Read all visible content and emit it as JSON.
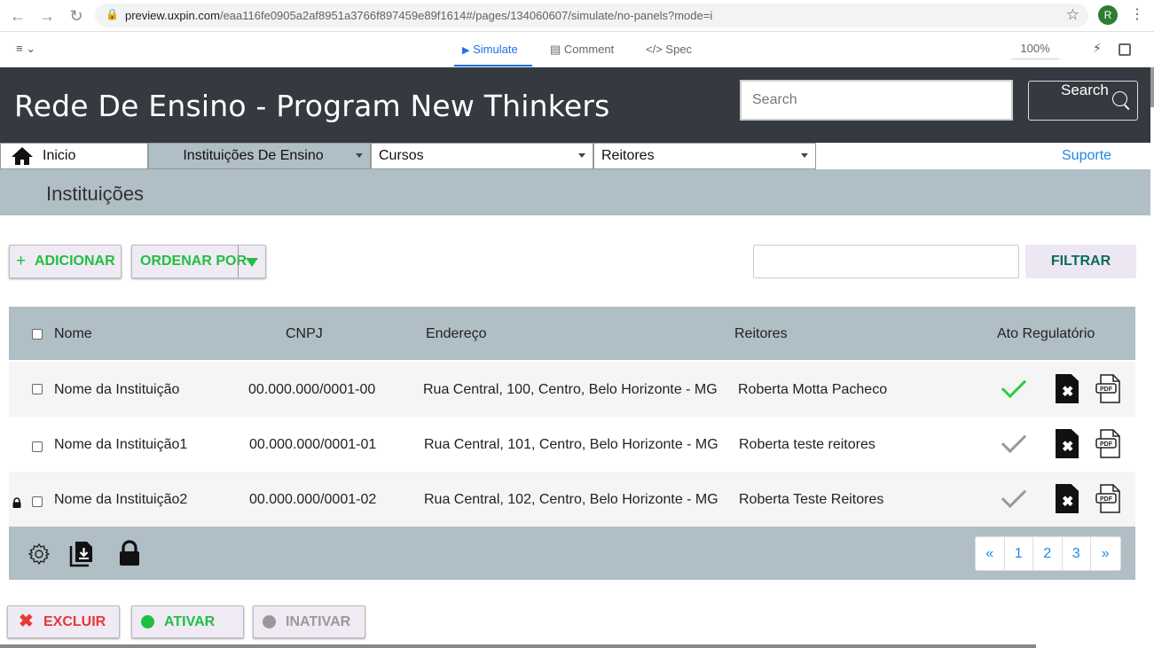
{
  "browser": {
    "url_host": "preview.uxpin.com",
    "url_path": "/eaa116fe0905a2af8951a3766f897459e89f1614#/pages/134060607/simulate/no-panels?mode=i",
    "avatar": "R"
  },
  "uxpin": {
    "menu_icon": "hamburger-icon",
    "tabs": [
      {
        "label": "Simulate",
        "icon": "play-icon"
      },
      {
        "label": "Comment",
        "icon": "comment-icon"
      },
      {
        "label": "Spec",
        "icon": "code-icon"
      }
    ],
    "zoom": "100%"
  },
  "header": {
    "title": "Rede De Ensino - Program New Thinkers",
    "search_placeholder": "Search",
    "search_button": "Search"
  },
  "nav": {
    "home": "Inicio",
    "instituicoes": "Instituições De Ensino",
    "cursos": "Cursos",
    "reitores": "Reitores",
    "suporte": "Suporte"
  },
  "section": {
    "title": "Instituições"
  },
  "actions": {
    "adicionar": "ADICIONAR",
    "ordenar": "ORDENAR POR",
    "filtrar": "FILTRAR",
    "filter_value": ""
  },
  "table": {
    "headers": {
      "nome": "Nome",
      "cnpj": "CNPJ",
      "endereco": "Endereço",
      "reitores": "Reitores",
      "ato": "Ato Regulatório"
    },
    "rows": [
      {
        "nome": "Nome da Instituição",
        "cnpj": "00.000.000/0001-00",
        "endereco": "Rua Central, 100,  Centro, Belo Horizonte - MG",
        "reitores": "Roberta Motta Pacheco",
        "ato_status": "active"
      },
      {
        "nome": "Nome da Instituição1",
        "cnpj": "00.000.000/0001-01",
        "endereco": "Rua Central, 101,  Centro, Belo Horizonte - MG",
        "reitores": "Roberta teste reitores",
        "ato_status": "inactive"
      },
      {
        "nome": "Nome da Instituição2",
        "cnpj": "00.000.000/0001-02",
        "endereco": "Rua Central, 102,  Centro, Belo Horizonte - MG",
        "reitores": "Roberta Teste Reitores",
        "ato_status": "inactive",
        "locked": true
      }
    ]
  },
  "pagination": {
    "prev": "«",
    "pages": [
      "1",
      "2",
      "3"
    ],
    "next": "»"
  },
  "bottom": {
    "excluir": "EXCLUIR",
    "ativar": "ATIVAR",
    "inativar": "INATIVAR"
  },
  "colors": {
    "header_bg": "#343a40",
    "section_bg": "#b0bec5",
    "green": "#1fbf3f",
    "red": "#e53935",
    "link": "#1e88e5"
  }
}
